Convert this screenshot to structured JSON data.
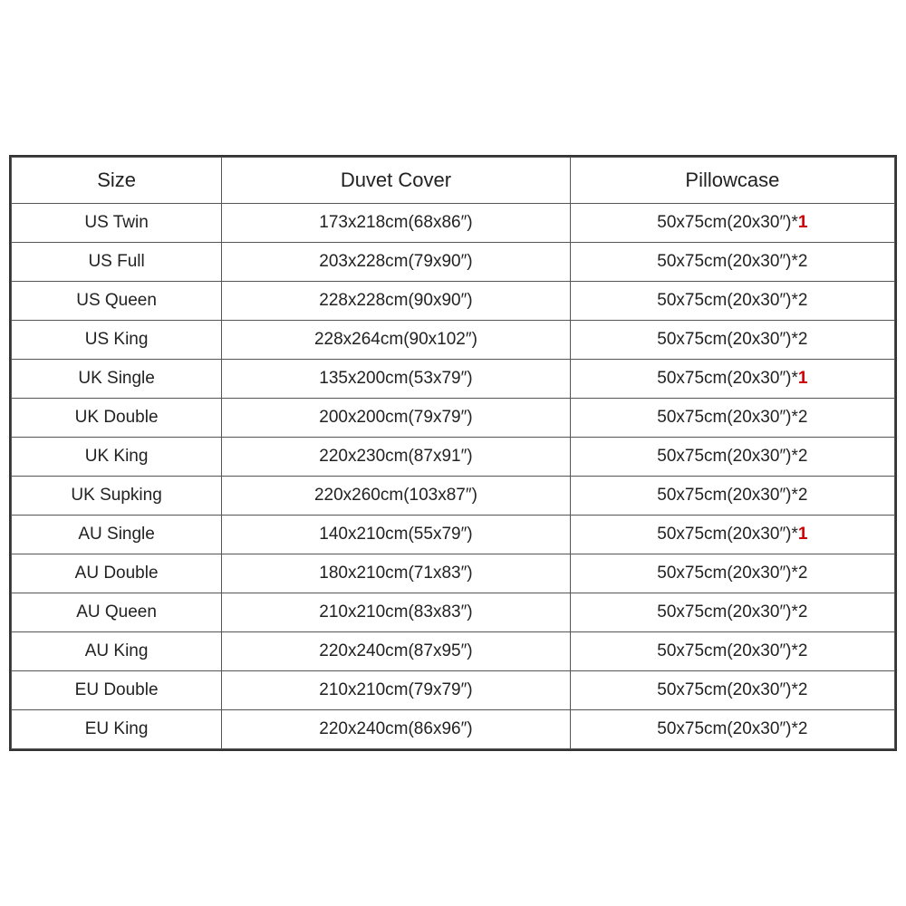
{
  "table": {
    "headers": [
      "Size",
      "Duvet Cover",
      "Pillowcase"
    ],
    "rows": [
      {
        "size": "US Twin",
        "duvet": "173x218cm(68x86″)",
        "pillow": "50x75cm(20x30″)*",
        "pillowSuffix": "1",
        "pillowRed": true
      },
      {
        "size": "US Full",
        "duvet": "203x228cm(79x90″)",
        "pillow": "50x75cm(20x30″)*2",
        "pillowSuffix": "",
        "pillowRed": false
      },
      {
        "size": "US Queen",
        "duvet": "228x228cm(90x90″)",
        "pillow": "50x75cm(20x30″)*2",
        "pillowSuffix": "",
        "pillowRed": false
      },
      {
        "size": "US King",
        "duvet": "228x264cm(90x102″)",
        "pillow": "50x75cm(20x30″)*2",
        "pillowSuffix": "",
        "pillowRed": false
      },
      {
        "size": "UK Single",
        "duvet": "135x200cm(53x79″)",
        "pillow": "50x75cm(20x30″)*",
        "pillowSuffix": "1",
        "pillowRed": true
      },
      {
        "size": "UK Double",
        "duvet": "200x200cm(79x79″)",
        "pillow": "50x75cm(20x30″)*2",
        "pillowSuffix": "",
        "pillowRed": false
      },
      {
        "size": "UK King",
        "duvet": "220x230cm(87x91″)",
        "pillow": "50x75cm(20x30″)*2",
        "pillowSuffix": "",
        "pillowRed": false
      },
      {
        "size": "UK Supking",
        "duvet": "220x260cm(103x87″)",
        "pillow": "50x75cm(20x30″)*2",
        "pillowSuffix": "",
        "pillowRed": false
      },
      {
        "size": "AU Single",
        "duvet": "140x210cm(55x79″)",
        "pillow": "50x75cm(20x30″)*",
        "pillowSuffix": "1",
        "pillowRed": true
      },
      {
        "size": "AU Double",
        "duvet": "180x210cm(71x83″)",
        "pillow": "50x75cm(20x30″)*2",
        "pillowSuffix": "",
        "pillowRed": false
      },
      {
        "size": "AU Queen",
        "duvet": "210x210cm(83x83″)",
        "pillow": "50x75cm(20x30″)*2",
        "pillowSuffix": "",
        "pillowRed": false
      },
      {
        "size": "AU King",
        "duvet": "220x240cm(87x95″)",
        "pillow": "50x75cm(20x30″)*2",
        "pillowSuffix": "",
        "pillowRed": false
      },
      {
        "size": "EU Double",
        "duvet": "210x210cm(79x79″)",
        "pillow": "50x75cm(20x30″)*2",
        "pillowSuffix": "",
        "pillowRed": false
      },
      {
        "size": "EU King",
        "duvet": "220x240cm(86x96″)",
        "pillow": "50x75cm(20x30″)*2",
        "pillowSuffix": "",
        "pillowRed": false
      }
    ]
  }
}
